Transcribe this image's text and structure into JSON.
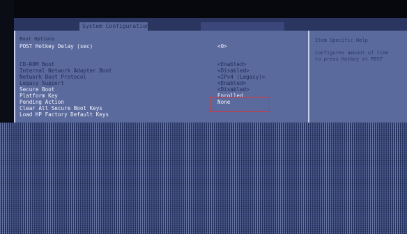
{
  "tabs": {
    "active_label": "System Configuration"
  },
  "section_label": "Boot Options",
  "rows": [
    {
      "label": "POST Hotkey Delay (sec)",
      "value": "<0>"
    },
    {
      "label": "CD-ROM Boot",
      "value": "<Enabled>"
    },
    {
      "label": "Internal Network Adapter Boot",
      "value": "<Disabled>"
    },
    {
      "label": "Network Boot Protocol",
      "value": "<IPv4 (Legacy)>"
    },
    {
      "label": "Legacy Support",
      "value": "<Enabled>"
    },
    {
      "label": "Secure Boot",
      "value": "<Disabled>"
    },
    {
      "label": "Platform Key",
      "value": "Enrolled"
    },
    {
      "label": "Pending Action",
      "value": "None"
    },
    {
      "label": "Clear All Secure Boot Keys",
      "value": ""
    },
    {
      "label": "Load HP Factory Default Keys",
      "value": ""
    }
  ],
  "help": {
    "title": "Item Specific Help",
    "lines": [
      "Configures amount of time",
      "to press Hotkey at POST"
    ]
  },
  "colors": {
    "highlight_box": "#e0303a",
    "screen_bg": "#5b6a9c"
  }
}
